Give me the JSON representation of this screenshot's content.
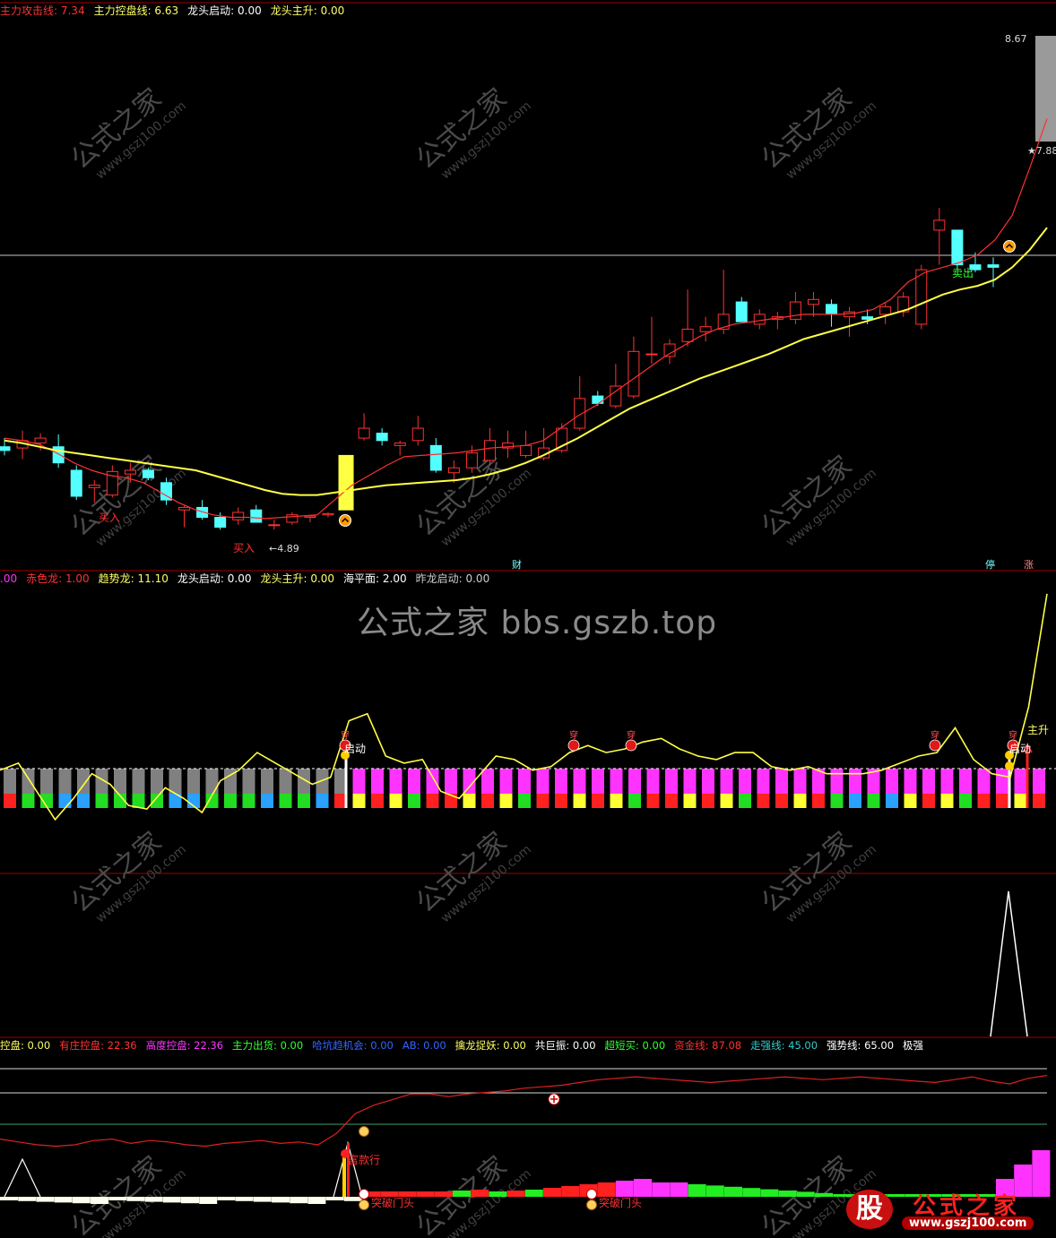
{
  "panel1": {
    "header": [
      {
        "label": "主力攻击线: 7.34",
        "color": "#ff3333"
      },
      {
        "label": "主力控盘线: 6.63",
        "color": "#ffff66"
      },
      {
        "label": "龙头启动: 0.00",
        "color": "#ffffff"
      },
      {
        "label": "龙头主升: 0.00",
        "color": "#ffff66"
      }
    ],
    "price_high_label": "8.67",
    "price_star_label": "★7.88",
    "low_label": "4.89",
    "buy_label": "买入",
    "sell_label": "卖出",
    "bottom_tags": [
      {
        "text": "财",
        "x": 575
      },
      {
        "text": "停",
        "x": 1103
      },
      {
        "text": "涨",
        "x": 1146
      }
    ]
  },
  "panel2": {
    "header": [
      {
        "label": ".00",
        "color": "#ff33ff"
      },
      {
        "label": "赤色龙: 1.00",
        "color": "#ff3333"
      },
      {
        "label": "趋势龙: 11.10",
        "color": "#ffff66"
      },
      {
        "label": "龙头启动: 0.00",
        "color": "#ffffff"
      },
      {
        "label": "龙头主升: 0.00",
        "color": "#ffff66"
      },
      {
        "label": "海平面: 2.00",
        "color": "#ffffff"
      },
      {
        "label": "昨龙启动: 0.00",
        "color": "#cccccc"
      }
    ],
    "center_watermark": "公式之家 bbs.gszb.top",
    "start_label": "启动",
    "main_rise_label": "主升",
    "chuan_label": "穿"
  },
  "panel4": {
    "header": [
      {
        "label": "控盘: 0.00",
        "color": "#ffff66"
      },
      {
        "label": "有庄控盘: 22.36",
        "color": "#ff3333"
      },
      {
        "label": "高度控盘: 22.36",
        "color": "#ff33ff"
      },
      {
        "label": "主力出货: 0.00",
        "color": "#33ff33"
      },
      {
        "label": "哈坑趋机会: 0.00",
        "color": "#3366ff"
      },
      {
        "label": "AB: 0.00",
        "color": "#3366ff"
      },
      {
        "label": "擒龙捉妖: 0.00",
        "color": "#ffff66"
      },
      {
        "label": "共巨振: 0.00",
        "color": "#ffffff"
      },
      {
        "label": "超短买: 0.00",
        "color": "#33ff33"
      },
      {
        "label": "资金线: 87.08",
        "color": "#ff3333"
      },
      {
        "label": "走强线: 45.00",
        "color": "#33cccc"
      },
      {
        "label": "强势线: 65.00",
        "color": "#ffffff"
      },
      {
        "label": "极强",
        "color": "#ffffff"
      }
    ],
    "label_breakout_1": "突破门头",
    "label_breakout_2": "突破门头",
    "label_bank": "富款行"
  },
  "watermark_text": "公式之家",
  "watermark_url": "www.gszj100.com",
  "logo": {
    "brand": "公式之家",
    "url": "www.gszj100.com",
    "mark": "股"
  },
  "colors": {
    "up": "#ff3232",
    "down": "#54ffff",
    "ma_white": "#ffffff",
    "ma_yellow": "#ffff44",
    "grid": "#a00000"
  },
  "chart_data": [
    {
      "type": "candlestick",
      "title": "",
      "ylim": [
        4.6,
        9.0
      ],
      "candles": [
        {
          "o": 5.55,
          "h": 5.62,
          "l": 5.48,
          "c": 5.52
        },
        {
          "o": 5.54,
          "h": 5.68,
          "l": 5.45,
          "c": 5.6
        },
        {
          "o": 5.58,
          "h": 5.66,
          "l": 5.52,
          "c": 5.62
        },
        {
          "o": 5.55,
          "h": 5.65,
          "l": 5.38,
          "c": 5.42
        },
        {
          "o": 5.36,
          "h": 5.4,
          "l": 5.12,
          "c": 5.15
        },
        {
          "o": 5.22,
          "h": 5.28,
          "l": 5.1,
          "c": 5.24
        },
        {
          "o": 5.16,
          "h": 5.4,
          "l": 5.14,
          "c": 5.35
        },
        {
          "o": 5.33,
          "h": 5.42,
          "l": 5.26,
          "c": 5.36
        },
        {
          "o": 5.36,
          "h": 5.38,
          "l": 5.28,
          "c": 5.3
        },
        {
          "o": 5.26,
          "h": 5.3,
          "l": 5.08,
          "c": 5.12
        },
        {
          "o": 5.04,
          "h": 5.08,
          "l": 4.9,
          "c": 5.06
        },
        {
          "o": 5.06,
          "h": 5.12,
          "l": 4.96,
          "c": 4.98
        },
        {
          "o": 4.98,
          "h": 5.02,
          "l": 4.88,
          "c": 4.9
        },
        {
          "o": 4.96,
          "h": 5.06,
          "l": 4.92,
          "c": 5.02
        },
        {
          "o": 5.04,
          "h": 5.08,
          "l": 4.96,
          "c": 4.94
        },
        {
          "o": 4.92,
          "h": 4.96,
          "l": 4.88,
          "c": 4.92
        },
        {
          "o": 4.94,
          "h": 5.02,
          "l": 4.92,
          "c": 5.0
        },
        {
          "o": 4.98,
          "h": 5.0,
          "l": 4.94,
          "c": 4.99
        },
        {
          "o": 5.0,
          "h": 5.02,
          "l": 4.98,
          "c": 5.01
        },
        {
          "o": 5.04,
          "h": 5.48,
          "l": 5.04,
          "c": 5.48
        },
        {
          "o": 5.62,
          "h": 5.82,
          "l": 5.6,
          "c": 5.7
        },
        {
          "o": 5.66,
          "h": 5.7,
          "l": 5.56,
          "c": 5.6
        },
        {
          "o": 5.56,
          "h": 5.6,
          "l": 5.48,
          "c": 5.58
        },
        {
          "o": 5.6,
          "h": 5.8,
          "l": 5.56,
          "c": 5.7
        },
        {
          "o": 5.56,
          "h": 5.62,
          "l": 5.34,
          "c": 5.36
        },
        {
          "o": 5.34,
          "h": 5.44,
          "l": 5.26,
          "c": 5.38
        },
        {
          "o": 5.38,
          "h": 5.56,
          "l": 5.34,
          "c": 5.5
        },
        {
          "o": 5.44,
          "h": 5.7,
          "l": 5.4,
          "c": 5.6
        },
        {
          "o": 5.54,
          "h": 5.68,
          "l": 5.46,
          "c": 5.58
        },
        {
          "o": 5.48,
          "h": 5.68,
          "l": 5.46,
          "c": 5.56
        },
        {
          "o": 5.46,
          "h": 5.7,
          "l": 5.44,
          "c": 5.54
        },
        {
          "o": 5.52,
          "h": 5.74,
          "l": 5.5,
          "c": 5.7
        },
        {
          "o": 5.7,
          "h": 6.12,
          "l": 5.68,
          "c": 5.94
        },
        {
          "o": 5.96,
          "h": 6.0,
          "l": 5.88,
          "c": 5.9
        },
        {
          "o": 5.88,
          "h": 6.22,
          "l": 5.86,
          "c": 6.04
        },
        {
          "o": 5.96,
          "h": 6.44,
          "l": 5.94,
          "c": 6.32
        },
        {
          "o": 6.3,
          "h": 6.6,
          "l": 6.22,
          "c": 6.3
        },
        {
          "o": 6.28,
          "h": 6.42,
          "l": 6.22,
          "c": 6.38
        },
        {
          "o": 6.4,
          "h": 6.82,
          "l": 6.36,
          "c": 6.5
        },
        {
          "o": 6.48,
          "h": 6.6,
          "l": 6.4,
          "c": 6.52
        },
        {
          "o": 6.5,
          "h": 6.98,
          "l": 6.46,
          "c": 6.62
        },
        {
          "o": 6.72,
          "h": 6.76,
          "l": 6.56,
          "c": 6.56
        },
        {
          "o": 6.54,
          "h": 6.66,
          "l": 6.5,
          "c": 6.62
        },
        {
          "o": 6.58,
          "h": 6.64,
          "l": 6.5,
          "c": 6.6
        },
        {
          "o": 6.58,
          "h": 6.8,
          "l": 6.54,
          "c": 6.72
        },
        {
          "o": 6.7,
          "h": 6.8,
          "l": 6.6,
          "c": 6.74
        },
        {
          "o": 6.7,
          "h": 6.74,
          "l": 6.52,
          "c": 6.62
        },
        {
          "o": 6.6,
          "h": 6.68,
          "l": 6.44,
          "c": 6.64
        },
        {
          "o": 6.6,
          "h": 6.66,
          "l": 6.54,
          "c": 6.58
        },
        {
          "o": 6.62,
          "h": 6.72,
          "l": 6.54,
          "c": 6.68
        },
        {
          "o": 6.64,
          "h": 6.8,
          "l": 6.6,
          "c": 6.76
        },
        {
          "o": 6.54,
          "h": 7.02,
          "l": 6.5,
          "c": 6.98
        },
        {
          "o": 7.3,
          "h": 7.48,
          "l": 7.02,
          "c": 7.38
        },
        {
          "o": 7.3,
          "h": 7.3,
          "l": 6.98,
          "c": 7.02
        },
        {
          "o": 7.02,
          "h": 7.12,
          "l": 6.96,
          "c": 6.98
        },
        {
          "o": 7.02,
          "h": 7.08,
          "l": 6.84,
          "c": 7.0
        }
      ],
      "ma_short": [
        5.62,
        5.6,
        5.57,
        5.5,
        5.42,
        5.36,
        5.32,
        5.3,
        5.26,
        5.18,
        5.1,
        5.04,
        5.0,
        4.98,
        4.98,
        4.97,
        4.98,
        4.99,
        5.0,
        5.12,
        5.24,
        5.32,
        5.4,
        5.47,
        5.48,
        5.49,
        5.5,
        5.52,
        5.54,
        5.55,
        5.56,
        5.6,
        5.7,
        5.8,
        5.88,
        5.98,
        6.08,
        6.18,
        6.28,
        6.36,
        6.44,
        6.5,
        6.54,
        6.56,
        6.58,
        6.6,
        6.62,
        6.62,
        6.62,
        6.63,
        6.66,
        6.74,
        6.88,
        6.96,
        7.0,
        7.04,
        7.1,
        7.22,
        7.42,
        7.8,
        8.2
      ],
      "ma_long": [
        5.6,
        5.58,
        5.55,
        5.52,
        5.5,
        5.48,
        5.46,
        5.44,
        5.42,
        5.4,
        5.38,
        5.36,
        5.32,
        5.28,
        5.24,
        5.2,
        5.17,
        5.16,
        5.16,
        5.18,
        5.2,
        5.22,
        5.24,
        5.25,
        5.26,
        5.27,
        5.28,
        5.3,
        5.33,
        5.37,
        5.42,
        5.48,
        5.55,
        5.62,
        5.7,
        5.78,
        5.86,
        5.92,
        5.98,
        6.04,
        6.1,
        6.15,
        6.2,
        6.25,
        6.3,
        6.36,
        6.42,
        6.46,
        6.5,
        6.54,
        6.58,
        6.62,
        6.66,
        6.72,
        6.78,
        6.82,
        6.85,
        6.9,
        7.0,
        7.14,
        7.32
      ]
    },
    {
      "type": "line",
      "series": [
        {
          "name": "趋势龙",
          "values": [
            28,
            30,
            22,
            14,
            20,
            27,
            24,
            18,
            17,
            23,
            20,
            16,
            25,
            28,
            33,
            30,
            27,
            24,
            26,
            42,
            44,
            32,
            30,
            31,
            22,
            20,
            26,
            32,
            31,
            28,
            29,
            33,
            35,
            33,
            34,
            36,
            37,
            34,
            32,
            31,
            33,
            33,
            29,
            28,
            29,
            27,
            27,
            27,
            28,
            30,
            32,
            33,
            40,
            31,
            27,
            26,
            46,
            78
          ]
        }
      ]
    },
    {
      "type": "line",
      "series": [
        {
          "name": "",
          "values": [
            0,
            0,
            0,
            0,
            0,
            0,
            0,
            0,
            0,
            0,
            0,
            0,
            0,
            0,
            0,
            0,
            0,
            0,
            0,
            0,
            0,
            0,
            0,
            0,
            0,
            0,
            0,
            0,
            0,
            0,
            0,
            0,
            0,
            0,
            0,
            0,
            0,
            0,
            0,
            0,
            0,
            0,
            0,
            0,
            0,
            0,
            0,
            0,
            0,
            0,
            0,
            0,
            0,
            0,
            0,
            100,
            0
          ]
        }
      ]
    },
    {
      "type": "area",
      "series": [
        {
          "name": "资金线",
          "values": [
            42,
            40,
            38,
            37,
            38,
            41,
            42,
            39,
            41,
            40,
            38,
            37,
            39,
            40,
            41,
            39,
            40,
            38,
            46,
            60,
            66,
            70,
            74,
            74,
            72,
            74,
            75,
            76,
            78,
            79,
            80,
            82,
            84,
            85,
            86,
            85,
            84,
            83,
            82,
            83,
            84,
            85,
            86,
            85,
            84,
            85,
            86,
            85,
            84,
            83,
            82,
            84,
            86,
            83,
            81,
            85,
            87
          ]
        }
      ]
    }
  ]
}
